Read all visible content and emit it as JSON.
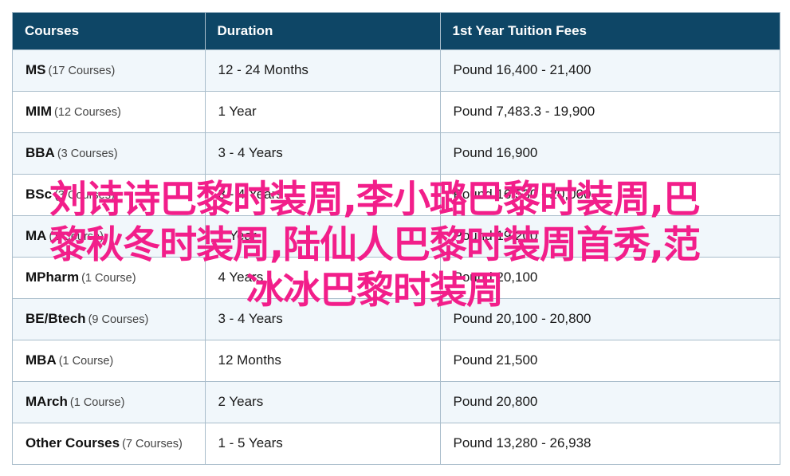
{
  "table": {
    "headers": [
      "Courses",
      "Duration",
      "1st Year Tuition Fees"
    ],
    "rows": [
      {
        "course": "MS",
        "count": "(17 Courses)",
        "duration": "12 - 24 Months",
        "fees": "Pound 16,400 - 21,400"
      },
      {
        "course": "MIM",
        "count": "(12 Courses)",
        "duration": "1 Year",
        "fees": "Pound 7,483.3 - 19,900"
      },
      {
        "course": "BBA",
        "count": "(3 Courses)",
        "duration": "3 - 4 Years",
        "fees": "Pound 16,900"
      },
      {
        "course": "BSc",
        "count": "(3 Courses)",
        "duration": "3 - 4 Years",
        "fees": "Pound 16,530 - 20,000"
      },
      {
        "course": "MA",
        "count": "(1 Course)",
        "duration": "1 Year",
        "fees": "Pound 19,200"
      },
      {
        "course": "MPharm",
        "count": "(1 Course)",
        "duration": "4 Years",
        "fees": "Pound 20,100"
      },
      {
        "course": "BE/Btech",
        "count": "(9 Courses)",
        "duration": "3 - 4 Years",
        "fees": "Pound 20,100 - 20,800"
      },
      {
        "course": "MBA",
        "count": "(1 Course)",
        "duration": "12 Months",
        "fees": "Pound 21,500"
      },
      {
        "course": "MArch",
        "count": "(1 Course)",
        "duration": "2 Years",
        "fees": "Pound 20,800"
      },
      {
        "course": "Other Courses",
        "count": "(7 Courses)",
        "duration": "1 - 5 Years",
        "fees": "Pound 13,280 - 26,938"
      }
    ]
  },
  "overlay": {
    "line1": "刘诗诗巴黎时装周,李小璐巴黎时装周,巴",
    "line2": "黎秋冬时装周,陆仙人巴黎时装周首秀,范",
    "line3": "冰冰巴黎时装周",
    "color": "#f21e8a"
  },
  "colors": {
    "header_bg": "#0e4666",
    "row_alt": "#f1f7fb",
    "border": "#a9bdcb"
  }
}
